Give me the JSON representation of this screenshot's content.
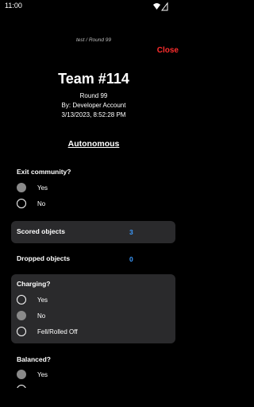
{
  "status_bar": {
    "time": "11:00",
    "icons": [
      "wifi-icon",
      "signal-icon"
    ]
  },
  "breadcrumb": "test / Round 99",
  "close_label": "Close",
  "team_title": "Team #114",
  "round": "Round 99",
  "author": "By: Developer Account",
  "timestamp": "3/13/2023, 8:52:28 PM",
  "section": "Autonomous",
  "exit_community": {
    "question": "Exit community?",
    "options": [
      {
        "label": "Yes",
        "selected": true
      },
      {
        "label": "No",
        "selected": false
      }
    ]
  },
  "scored": {
    "label": "Scored objects",
    "value": "3"
  },
  "dropped": {
    "label": "Dropped objects",
    "value": "0"
  },
  "charging": {
    "question": "Charging?",
    "options": [
      {
        "label": "Yes",
        "selected": false
      },
      {
        "label": "No",
        "selected": true
      },
      {
        "label": "Fell/Rolled Off",
        "selected": false
      }
    ]
  },
  "balanced": {
    "question": "Balanced?",
    "options": [
      {
        "label": "Yes",
        "selected": true
      }
    ]
  },
  "colors": {
    "accent": "#3b9bff",
    "close": "#ff2d2d",
    "panel": "#2a2a2c",
    "selected_radio": "#8a8a8a"
  }
}
